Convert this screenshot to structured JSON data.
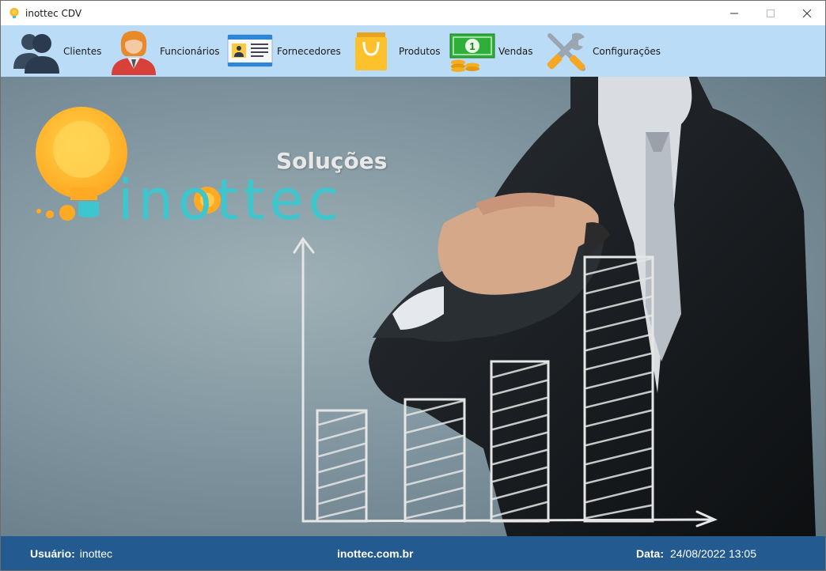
{
  "window": {
    "title": "inottec CDV",
    "controls": [
      "minimize",
      "maximize",
      "close"
    ]
  },
  "toolbar": {
    "items": [
      {
        "label": "Clientes",
        "icon": "clients-icon"
      },
      {
        "label": "Funcionários",
        "icon": "employee-icon"
      },
      {
        "label": "Fornecedores",
        "icon": "supplier-card-icon"
      },
      {
        "label": "Produtos",
        "icon": "shopping-bag-icon"
      },
      {
        "label": "Vendas",
        "icon": "money-icon"
      },
      {
        "label": "Configurações",
        "icon": "tools-icon"
      }
    ]
  },
  "logo": {
    "tagline": "Soluções",
    "brand": "inottec"
  },
  "status": {
    "user_label": "Usuário:",
    "user_value": "inottec",
    "site": "inottec.com.br",
    "date_label": "Data:",
    "date_value": "24/08/2022 13:05"
  },
  "colors": {
    "toolbar_bg": "#bbdcf7",
    "status_bg": "#235a8f",
    "brand_teal": "#3ec6cf",
    "brand_orange": "#ffb22e"
  }
}
